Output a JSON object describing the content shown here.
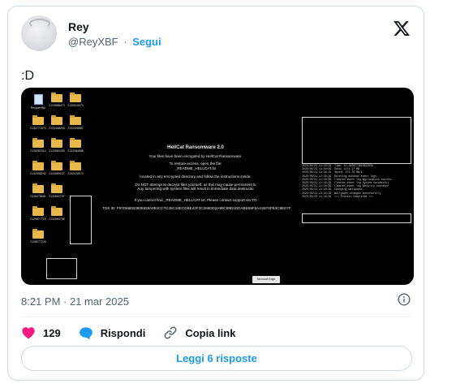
{
  "tweet": {
    "display_name": "Rey",
    "handle": "@ReyXBF",
    "separator": "·",
    "follow_label": "Segui",
    "text": ":D",
    "timestamp": "8:21 PM · 21 mar 2025",
    "likes": "129",
    "reply_label": "Rispondi",
    "copy_link_label": "Copia link",
    "read_replies_label": "Leggi 6 risposte",
    "colors": {
      "accent": "#1d9bf0",
      "like": "#f91880",
      "muted": "#536471"
    }
  },
  "screenshot": {
    "desktop_icons": [
      {
        "label": "Recycle Bin",
        "kind": "bin"
      },
      {
        "label": "2123588473",
        "kind": "folder"
      },
      {
        "label": "2132519379",
        "kind": "folder"
      },
      {
        "label": "2132771574",
        "kind": "folder"
      },
      {
        "label": "2132446225",
        "kind": "folder"
      },
      {
        "label": "2132458887",
        "kind": "folder"
      },
      {
        "label": "2128382314",
        "kind": "folder"
      },
      {
        "label": "2129960439",
        "kind": "folder"
      },
      {
        "label": "2132384888",
        "kind": "folder"
      },
      {
        "label": "2132552242",
        "kind": "folder"
      },
      {
        "label": "2132559127",
        "kind": "folder"
      },
      {
        "label": "2132470974",
        "kind": "folder"
      },
      {
        "label": "2126478661",
        "kind": "folder"
      },
      {
        "label": "2132501797",
        "kind": "folder"
      },
      {
        "label": "2129877715",
        "kind": "folder"
      },
      {
        "label": "2132560758",
        "kind": "folder"
      },
      {
        "label": "2128077225",
        "kind": "folder"
      }
    ],
    "note": {
      "title": "HellCat Ransomware 2.0",
      "line1": "Your files have been encrypted by HellCat Ransomware.",
      "line2a": "To restore access, open the file:",
      "line2b": "_README_HELLCAT.txt",
      "line3": "located in any encrypted directory and follow the instructions inside.",
      "line4a": "Do NOT attempt to decrypt files yourself, as this may cause permanent lo",
      "line4b": "Any tampering with system files will result in immediate data destructio",
      "line5": "If you cannot find _README_HELLCAT.txt, Please contact support via TO",
      "tox": "TOX ID: F97D66EB3905928A053CC7C25C16ECDBE42F3C266DD2A99C89D1DDABE69F6A41EF5FB3C9EE7F"
    },
    "log_lines": [
      "2025/03/21 11:16:29  Time: 11.195877461091383s",
      "2025/03/21 11:16:29  Data: 1274.17 MB",
      "2025/03/21 11:16:29  Speed: 471.79 MB/s",
      "2025/03/21 11:16:29  Deleting Windows event logs...",
      "2025/03/21 11:16:29  Cleared event log application success",
      "2025/03/21 11:16:29  Cleared event log System successful",
      "2025/03/21 11:16:29  Cleared event log Security successf",
      "2025/03/21 11:16:29  Changing wallpaper...",
      "2025/03/21 11:16:29  Wallpaper changed successfully.",
      "2025/03/21 11:16:29  === Process Completed ==="
    ],
    "taskbar_label": "Microsoft Edge"
  }
}
